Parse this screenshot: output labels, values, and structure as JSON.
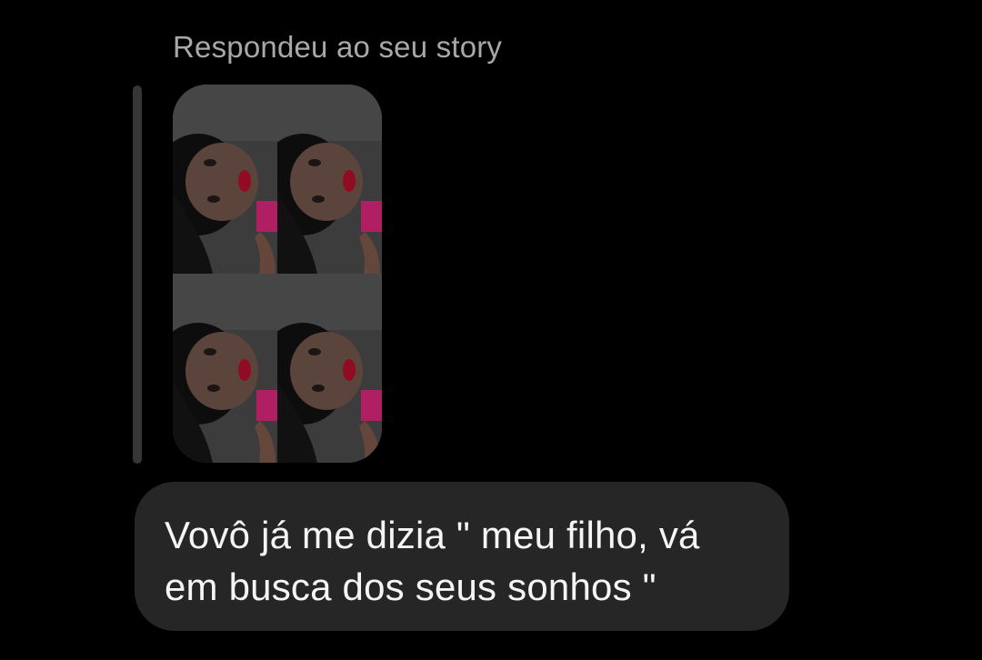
{
  "reply_context": {
    "label": "Respondeu ao seu story"
  },
  "story_preview": {
    "content": "four-photo-grid",
    "tiles": 4
  },
  "message": {
    "text": "Vovô já me dizia \" meu filho, vá\nem busca dos seus sonhos \""
  },
  "colors": {
    "background": "#000000",
    "bubble": "#262626",
    "reply_bar": "#363636",
    "context_text": "#a8a8a8",
    "message_text": "#f5f5f5",
    "lip_accent": "#b10f2a",
    "shirt_accent": "#d7257a"
  }
}
